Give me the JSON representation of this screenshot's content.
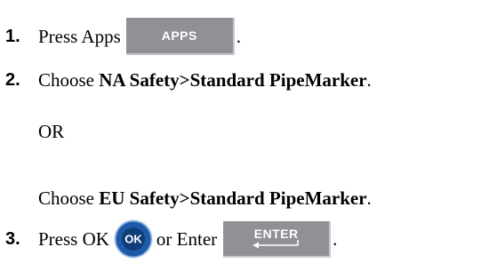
{
  "steps": [
    {
      "number": "1.",
      "text": "Press Apps",
      "key_label": "APPS",
      "suffix": "."
    },
    {
      "number": "2.",
      "prefix": "Choose ",
      "bold": "NA Safety>Standard PipeMarker",
      "suffix": "."
    },
    {
      "number": "3.",
      "text": "Press OK",
      "ok_label": "OK",
      "middle": "or Enter",
      "key_label": "ENTER",
      "suffix": "."
    }
  ],
  "or_text": "OR",
  "alt_choice": {
    "prefix": "Choose ",
    "bold": "EU Safety>Standard PipeMarker",
    "suffix": "."
  },
  "colors": {
    "key_face": "#8f9196",
    "ok_ring": "#1d5aa8",
    "ok_center": "#0f3d78"
  }
}
